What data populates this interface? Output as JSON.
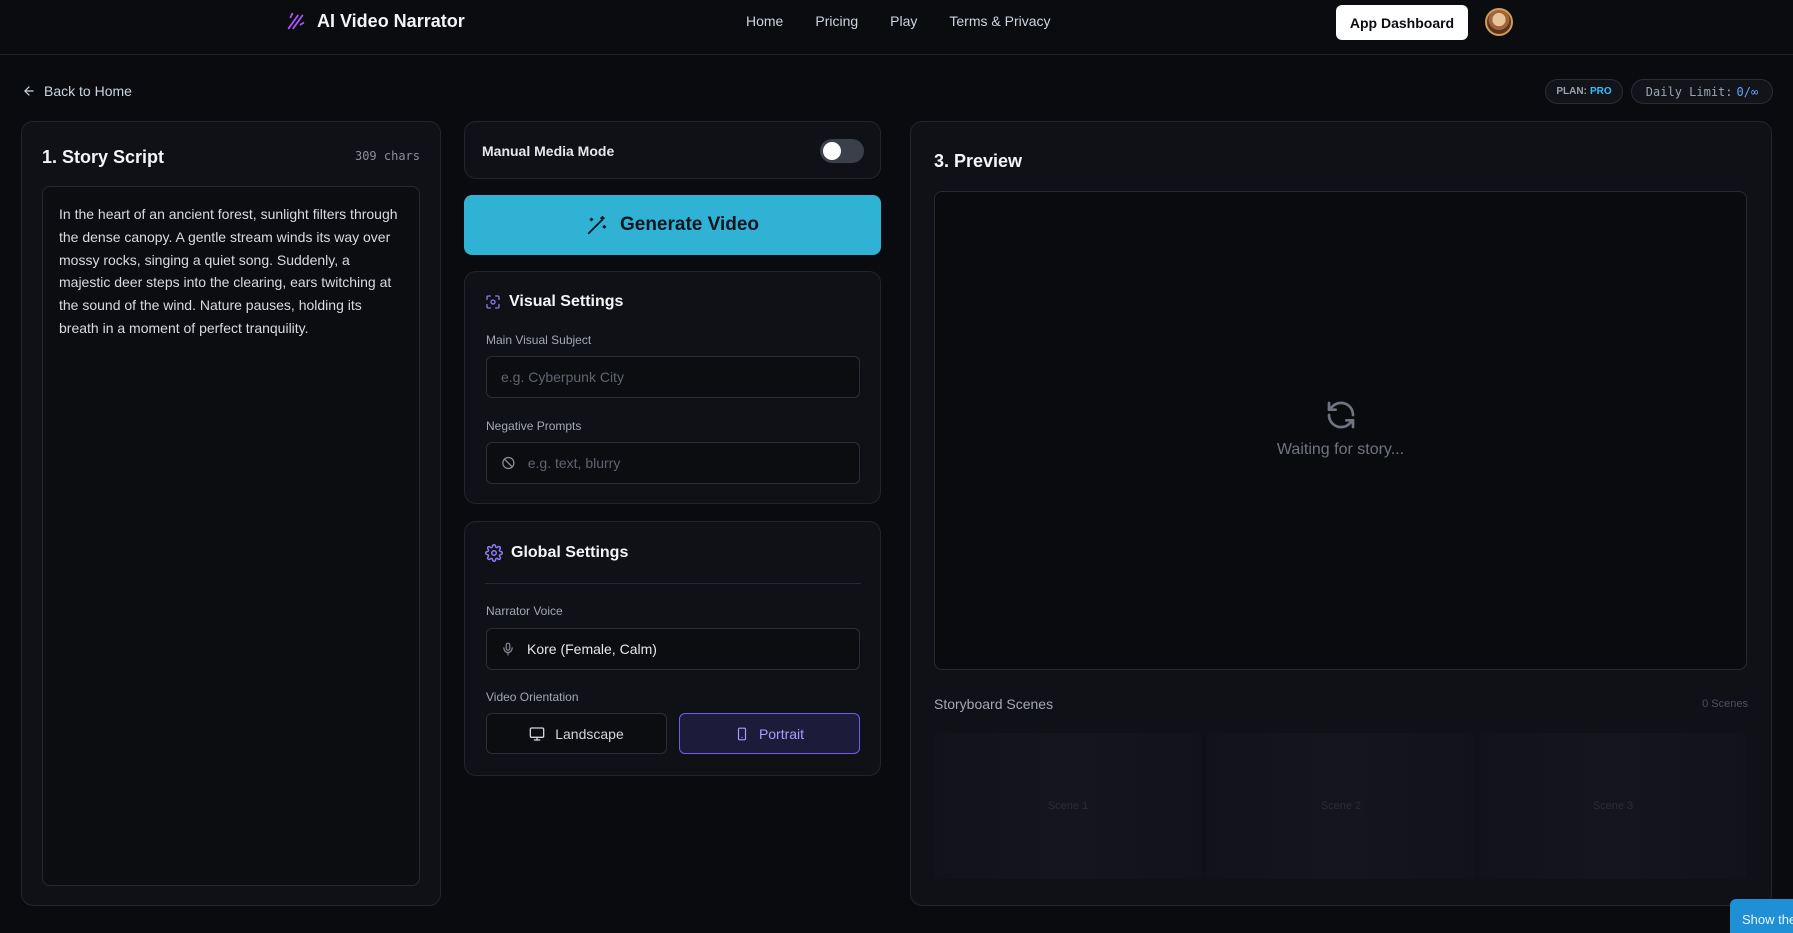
{
  "header": {
    "brand": "AI Video Narrator",
    "nav": [
      "Home",
      "Pricing",
      "Play",
      "Terms & Privacy"
    ],
    "dashboard_label": "App Dashboard"
  },
  "subbar": {
    "back_label": "Back to Home",
    "plan_label": "PLAN:",
    "plan_value": "PRO",
    "limit_label": "Daily Limit:",
    "limit_value": "0/∞"
  },
  "script": {
    "title": "1. Story Script",
    "char_count": "309 chars",
    "text": "In the heart of an ancient forest, sunlight filters through the dense canopy. A gentle stream winds its way over mossy rocks, singing a quiet song. Suddenly, a majestic deer steps into the clearing, ears twitching at the sound of the wind. Nature pauses, holding its breath in a moment of perfect tranquility."
  },
  "controls": {
    "manual_label": "Manual Media Mode",
    "manual_on": false,
    "generate_label": "Generate Video"
  },
  "visual": {
    "title": "Visual Settings",
    "subject_label": "Main Visual Subject",
    "subject_placeholder": "e.g. Cyberpunk City",
    "negative_label": "Negative Prompts",
    "negative_placeholder": "e.g. text, blurry"
  },
  "global": {
    "title": "Global Settings",
    "voice_label": "Narrator Voice",
    "voice_value": "Kore (Female, Calm)",
    "orientation_label": "Video Orientation",
    "landscape_label": "Landscape",
    "portrait_label": "Portrait",
    "selected": "Portrait"
  },
  "preview": {
    "title": "3. Preview",
    "waiting": "Waiting for story...",
    "storyboard_title": "Storyboard Scenes",
    "scene_count": "0 Scenes",
    "scenes": [
      "Scene 1",
      "Scene 2",
      "Scene 3"
    ]
  },
  "corner": {
    "label": "Show the"
  },
  "colors": {
    "accent": "#30b2d5",
    "purple": "#6d5ef0",
    "bg": "#0a0b0f"
  }
}
